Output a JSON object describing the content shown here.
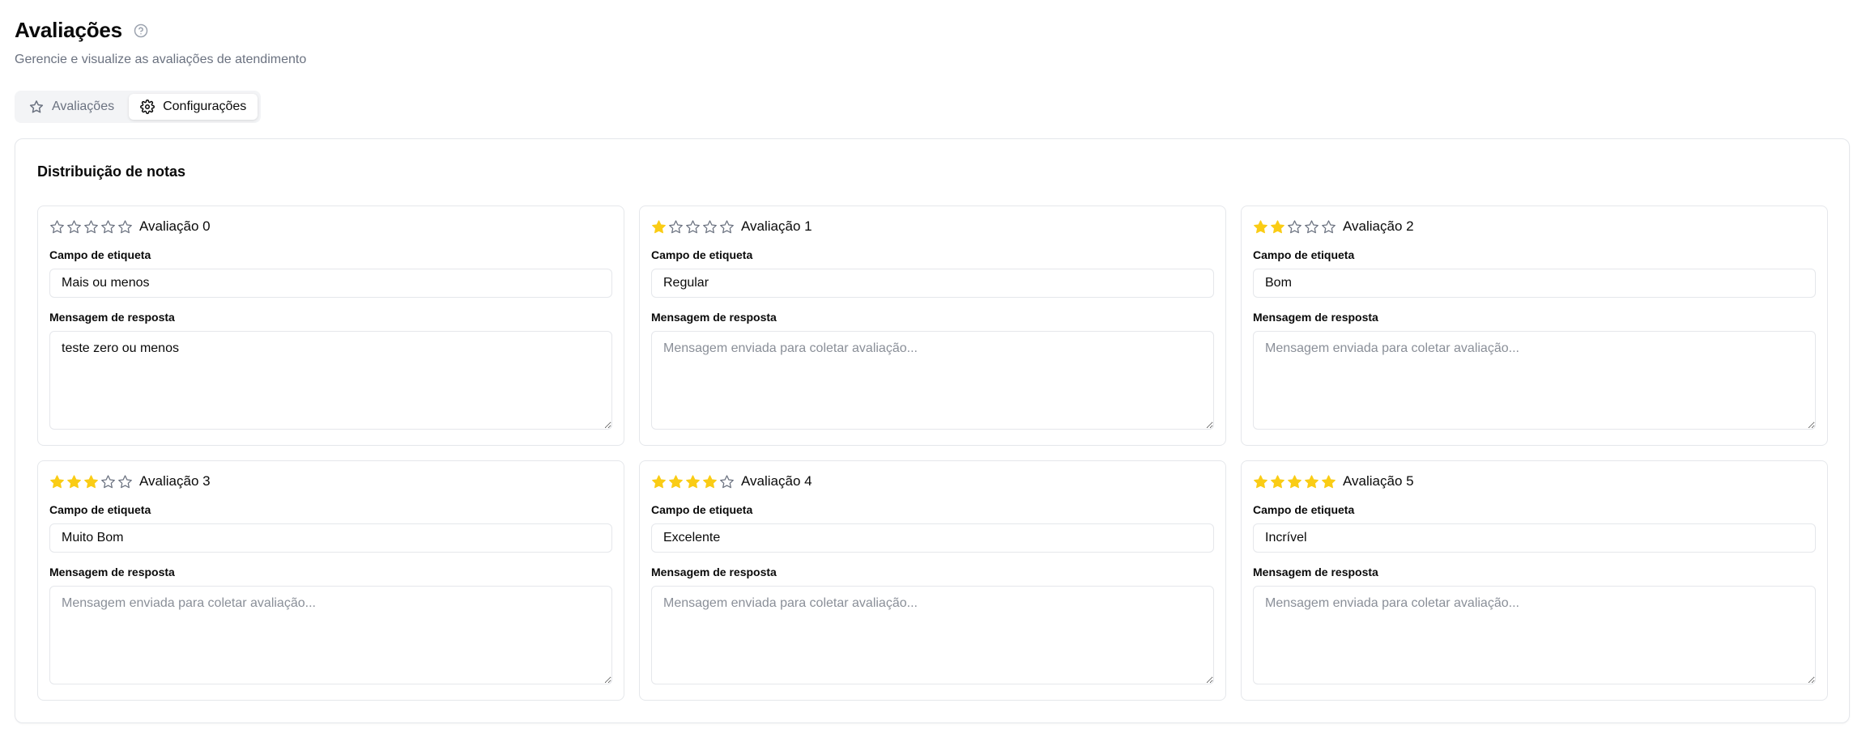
{
  "header": {
    "title": "Avaliações",
    "subtitle": "Gerencie e visualize as avaliações de atendimento",
    "help_icon": "help-circle-icon"
  },
  "tabs": [
    {
      "label": "Avaliações",
      "icon": "star-icon",
      "active": false
    },
    {
      "label": "Configurações",
      "icon": "gear-icon",
      "active": true
    }
  ],
  "panel": {
    "title": "Distribuição de notas",
    "label_field": "Campo de etiqueta",
    "message_field": "Mensagem de resposta",
    "cards": [
      {
        "title": "Avaliação 0",
        "filled": 0,
        "label_value": "Mais ou menos",
        "message_value": "teste zero ou menos",
        "message_placeholder": "Mensagem enviada para coletar avaliação..."
      },
      {
        "title": "Avaliação 1",
        "filled": 1,
        "label_value": "Regular",
        "message_value": "",
        "message_placeholder": "Mensagem enviada para coletar avaliação..."
      },
      {
        "title": "Avaliação 2",
        "filled": 2,
        "label_value": "Bom",
        "message_value": "",
        "message_placeholder": "Mensagem enviada para coletar avaliação..."
      },
      {
        "title": "Avaliação 3",
        "filled": 3,
        "label_value": "Muito Bom",
        "message_value": "",
        "message_placeholder": "Mensagem enviada para coletar avaliação..."
      },
      {
        "title": "Avaliação 4",
        "filled": 4,
        "label_value": "Excelente",
        "message_value": "",
        "message_placeholder": "Mensagem enviada para coletar avaliação..."
      },
      {
        "title": "Avaliação 5",
        "filled": 5,
        "label_value": "Incrível",
        "message_value": "",
        "message_placeholder": "Mensagem enviada para coletar avaliação..."
      }
    ]
  },
  "colors": {
    "star_filled": "#facc15",
    "star_empty": "#6b7280",
    "muted_text": "#6b7280"
  }
}
